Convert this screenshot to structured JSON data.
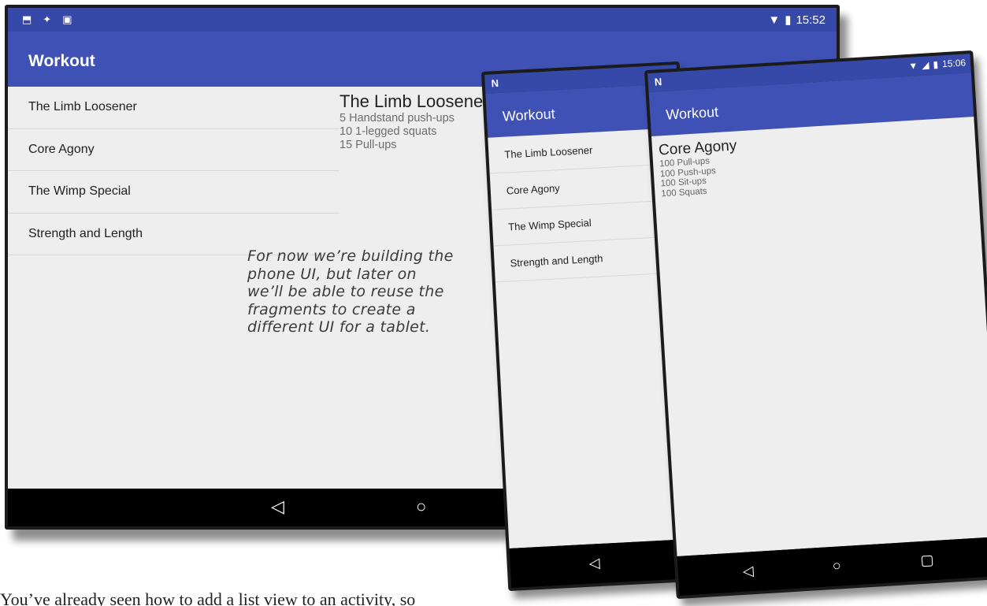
{
  "tablet": {
    "status": {
      "icons_left": [
        "download-icon",
        "debug-icon",
        "clipboard-icon"
      ],
      "time": "15:52"
    },
    "app_title": "Workout",
    "list": [
      "The Limb Loosener",
      "Core Agony",
      "The Wimp Special",
      "Strength and Length"
    ],
    "detail": {
      "title": "The Limb Loosener",
      "lines": [
        "5 Handstand push-ups",
        "10 1-legged squats",
        "15 Pull-ups"
      ]
    },
    "nav": {
      "back": "◁",
      "home": "○"
    }
  },
  "annotation": {
    "lines": [
      "For now we’re building the",
      "phone UI, but later on",
      "we’ll be able to reuse the",
      "fragments to create a",
      "different UI for a tablet."
    ]
  },
  "phone1": {
    "status": {
      "logo": "N"
    },
    "app_title": "Workout",
    "list": [
      "The Limb Loosener",
      "Core Agony",
      "The Wimp Special",
      "Strength and Length"
    ],
    "nav": {
      "back": "◁"
    }
  },
  "phone2": {
    "status": {
      "logo": "N",
      "time": "15:06"
    },
    "app_title": "Workout",
    "detail": {
      "title": "Core Agony",
      "lines": [
        "100 Pull-ups",
        "100 Push-ups",
        "100 Sit-ups",
        "100 Squats"
      ]
    },
    "nav": {
      "back": "◁",
      "home": "○",
      "recents": "▢"
    }
  },
  "body_text": "You’ve already seen how to add a list view to an activity, so",
  "colors": {
    "status_bar": "#3649a8",
    "app_bar": "#3f51b5",
    "content_bg": "#eeeeee",
    "nav_bar": "#000000"
  }
}
